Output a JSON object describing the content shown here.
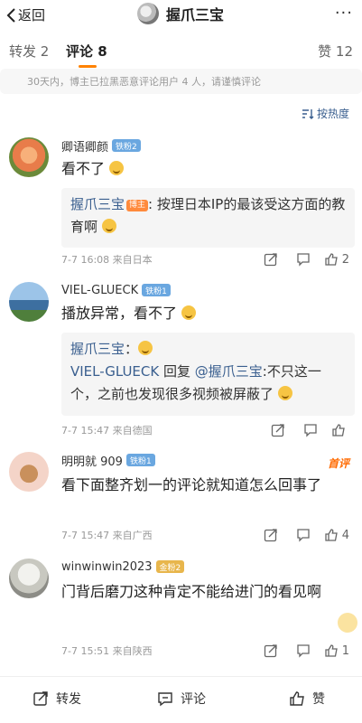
{
  "nav": {
    "back_label": "返回",
    "title": "握爪三宝",
    "more": "···"
  },
  "tabs": {
    "repost": "转发 2",
    "comment": "评论 8",
    "like": "赞 12"
  },
  "notice": "30天内，博主已拉黑恶意评论用户 4 人，请谨慎评论",
  "sort_label": "按热度",
  "comments": [
    {
      "user": "卿语卿颜",
      "badge": "铁粉2",
      "text": "看不了",
      "quote_user": "握爪三宝",
      "quote_tag": "博主",
      "quote_text": ": 按理日本IP的最该受这方面的教育啊",
      "time": "7-7 16:08",
      "location": "来自日本",
      "likes": "2"
    },
    {
      "user": "VIEL-GLUECK",
      "badge": "铁粉1",
      "text": "播放异常，看不了",
      "quote_user": "握爪三宝",
      "quote_text": "：",
      "reply_user": "VIEL-GLUECK",
      "reply_word": " 回复 ",
      "reply_target": "@握爪三宝",
      "reply_text": ":不只这一个，之前也发现很多视频被屏蔽了",
      "time": "7-7 15:47",
      "location": "来自德国",
      "likes": ""
    },
    {
      "user": "明明就 909",
      "badge": "铁粉1",
      "hot": "首评",
      "text": "看下面整齐划一的评论就知道怎么回事了",
      "time": "7-7 15:47",
      "location": "来自广西",
      "likes": "4"
    },
    {
      "user": "winwinwin2023",
      "badge": "金粉2",
      "text": "门背后磨刀这种肯定不能给进门的看见啊",
      "time": "7-7 15:51",
      "location": "来自陕西",
      "likes": "1"
    }
  ],
  "bottom": {
    "repost": "转发",
    "comment": "评论",
    "like": "赞"
  }
}
